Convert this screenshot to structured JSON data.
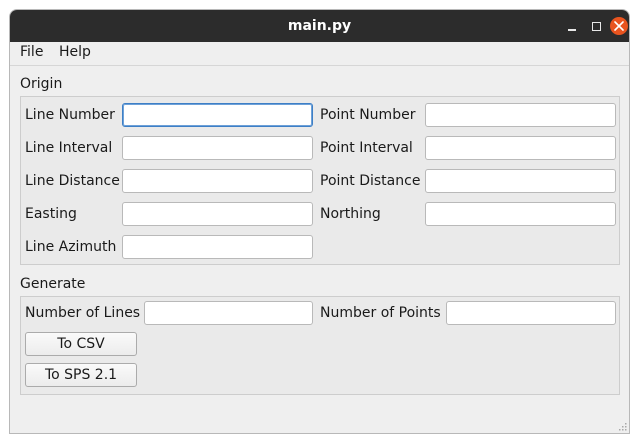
{
  "window": {
    "title": "main.py"
  },
  "menu": {
    "file": "File",
    "help": "Help"
  },
  "origin": {
    "title": "Origin",
    "line_number": {
      "label": "Line Number",
      "value": ""
    },
    "point_number": {
      "label": "Point Number",
      "value": ""
    },
    "line_interval": {
      "label": "Line Interval",
      "value": ""
    },
    "point_interval": {
      "label": "Point Interval",
      "value": ""
    },
    "line_distance": {
      "label": "Line Distance",
      "value": ""
    },
    "point_distance": {
      "label": "Point Distance",
      "value": ""
    },
    "easting": {
      "label": "Easting",
      "value": ""
    },
    "northing": {
      "label": "Northing",
      "value": ""
    },
    "line_azimuth": {
      "label": "Line Azimuth",
      "value": ""
    }
  },
  "generate": {
    "title": "Generate",
    "num_lines": {
      "label": "Number of Lines",
      "value": ""
    },
    "num_points": {
      "label": "Number of Points",
      "value": ""
    },
    "to_csv": "To CSV",
    "to_sps": "To SPS 2.1"
  },
  "colors": {
    "titlebar": "#2c2c2c",
    "close": "#e9541f",
    "focus": "#3d7fc6",
    "window_bg": "#efefef"
  }
}
